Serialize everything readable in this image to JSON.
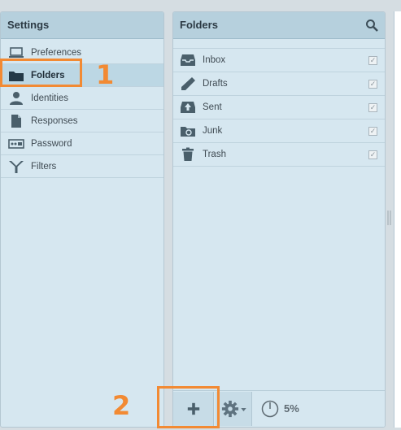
{
  "settings": {
    "title": "Settings",
    "items": [
      {
        "label": "Preferences",
        "icon": "laptop-icon"
      },
      {
        "label": "Folders",
        "icon": "folder-icon",
        "selected": true
      },
      {
        "label": "Identities",
        "icon": "person-icon"
      },
      {
        "label": "Responses",
        "icon": "document-icon"
      },
      {
        "label": "Password",
        "icon": "password-icon"
      },
      {
        "label": "Filters",
        "icon": "filter-icon"
      }
    ]
  },
  "folders": {
    "title": "Folders",
    "items": [
      {
        "label": "Inbox",
        "icon": "inbox-icon",
        "checked": true
      },
      {
        "label": "Drafts",
        "icon": "pencil-icon",
        "checked": true
      },
      {
        "label": "Sent",
        "icon": "sent-icon",
        "checked": true
      },
      {
        "label": "Junk",
        "icon": "junk-icon",
        "checked": true
      },
      {
        "label": "Trash",
        "icon": "trash-icon",
        "checked": true
      }
    ],
    "footer": {
      "add_icon": "plus-icon",
      "options_icon": "gear-icon",
      "quota_percent": "5%"
    }
  },
  "annotations": {
    "step1": "1",
    "step2": "2"
  },
  "colors": {
    "highlight": "#f28a33",
    "panel_bg": "#d6e7f0",
    "header_bg": "#b6d0dd",
    "icon": "#4a5f6b"
  }
}
